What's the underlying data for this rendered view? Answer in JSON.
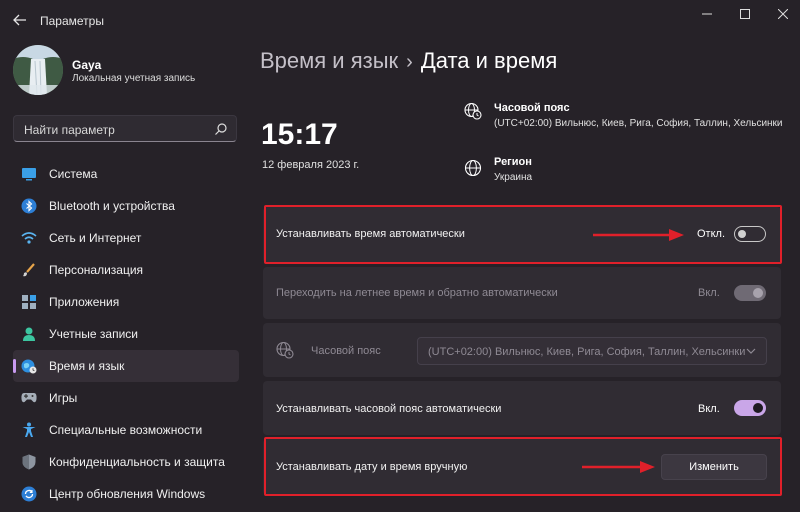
{
  "window": {
    "title": "Параметры"
  },
  "profile": {
    "name": "Gaya",
    "subtitle": "Локальная учетная запись"
  },
  "search": {
    "placeholder": "Найти параметр"
  },
  "nav": {
    "items": [
      {
        "label": "Система",
        "icon": "monitor-icon"
      },
      {
        "label": "Bluetooth и устройства",
        "icon": "bluetooth-icon"
      },
      {
        "label": "Сеть и Интернет",
        "icon": "wifi-icon"
      },
      {
        "label": "Персонализация",
        "icon": "brush-icon"
      },
      {
        "label": "Приложения",
        "icon": "apps-icon"
      },
      {
        "label": "Учетные записи",
        "icon": "person-icon"
      },
      {
        "label": "Время и язык",
        "icon": "globe-clock-icon",
        "active": true
      },
      {
        "label": "Игры",
        "icon": "gamepad-icon"
      },
      {
        "label": "Специальные возможности",
        "icon": "accessibility-icon"
      },
      {
        "label": "Конфиденциальность и защита",
        "icon": "shield-icon"
      },
      {
        "label": "Центр обновления Windows",
        "icon": "update-icon"
      }
    ]
  },
  "breadcrumb": {
    "parent": "Время и язык",
    "separator": "›",
    "current": "Дата и время"
  },
  "clock": {
    "time": "15:17",
    "date": "12 февраля 2023 г."
  },
  "timezone_info": {
    "title": "Часовой пояс",
    "value": "(UTC+02:00) Вильнюс, Киев, Рига, София, Таллин, Хельсинки"
  },
  "region_info": {
    "title": "Регион",
    "value": "Украина"
  },
  "settings": {
    "auto_time": {
      "label": "Устанавливать время автоматически",
      "state": "Откл."
    },
    "dst": {
      "label": "Переходить на летнее время и обратно автоматически",
      "state": "Вкл."
    },
    "timezone": {
      "label": "Часовой пояс",
      "selected": "(UTC+02:00) Вильнюс, Киев, Рига, София, Таллин, Хельсинки"
    },
    "auto_timezone": {
      "label": "Устанавливать часовой пояс автоматически",
      "state": "Вкл."
    },
    "manual": {
      "label": "Устанавливать дату и время вручную",
      "button": "Изменить"
    }
  },
  "colors": {
    "accent": "#c9a6e8",
    "highlight": "#e0202a",
    "background": "#262228",
    "card": "#302c33"
  }
}
